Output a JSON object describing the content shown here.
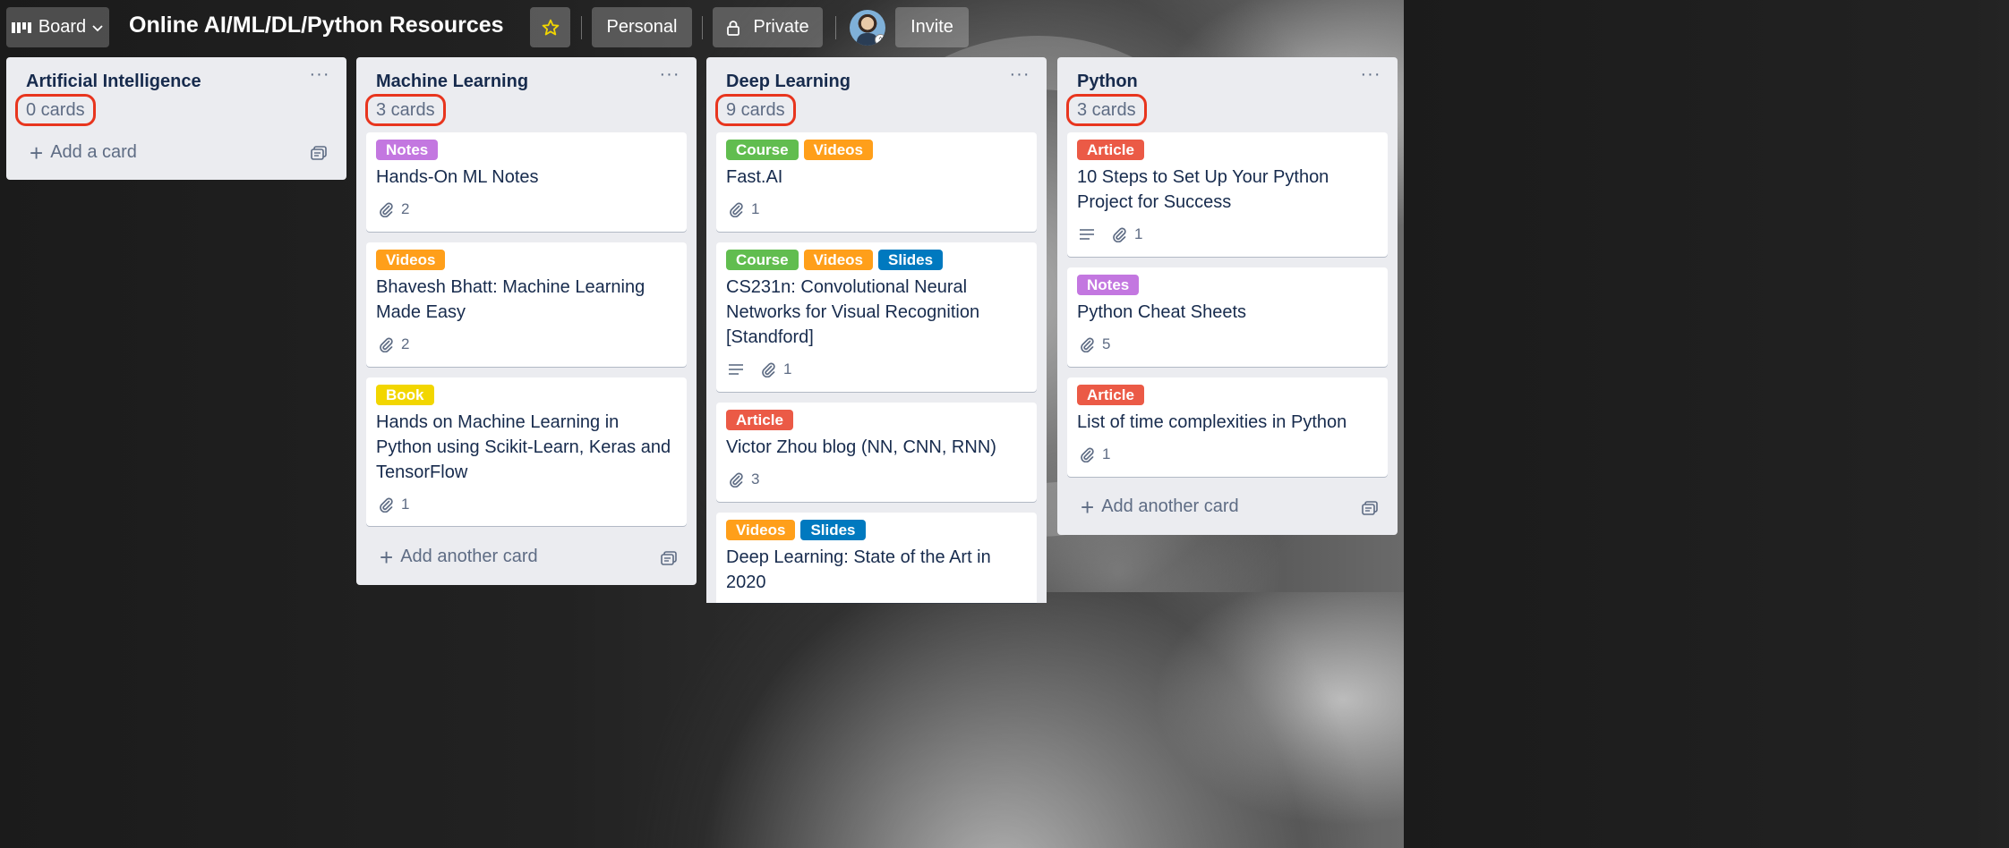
{
  "colors": {
    "notes": "#c377e0",
    "videos": "#ff9f1a",
    "book": "#f2d600",
    "course": "#61bd4f",
    "slides": "#0079bf",
    "article": "#eb5a46",
    "highlight": "#e8351e"
  },
  "header": {
    "board_label": "Board",
    "board_icon": "board-icon",
    "title": "Online AI/ML/DL/Python Resources",
    "star_icon": "star-icon",
    "personal_label": "Personal",
    "private_label": "Private",
    "private_icon": "lock-icon",
    "invite_label": "Invite"
  },
  "lists": [
    {
      "title": "Artificial Intelligence",
      "count": "0 cards",
      "add_label": "Add a card",
      "cards": []
    },
    {
      "title": "Machine Learning",
      "count": "3 cards",
      "add_label": "Add another card",
      "cards": [
        {
          "labels": [
            "Notes"
          ],
          "title": "Hands-On ML Notes",
          "attachments": "2",
          "has_description": false
        },
        {
          "labels": [
            "Videos"
          ],
          "title": "Bhavesh Bhatt: Machine Learning Made Easy",
          "attachments": "2",
          "has_description": false
        },
        {
          "labels": [
            "Book"
          ],
          "title": "Hands on Machine Learning in Python using Scikit-Learn, Keras and TensorFlow",
          "attachments": "1",
          "has_description": false
        }
      ]
    },
    {
      "title": "Deep Learning",
      "count": "9 cards",
      "cards": [
        {
          "labels": [
            "Course",
            "Videos"
          ],
          "title": "Fast.AI",
          "attachments": "1",
          "has_description": false
        },
        {
          "labels": [
            "Course",
            "Videos",
            "Slides"
          ],
          "title": "CS231n: Convolutional Neural Networks for Visual Recognition [Standford]",
          "attachments": "1",
          "has_description": true
        },
        {
          "labels": [
            "Article"
          ],
          "title": "Victor Zhou blog (NN, CNN, RNN)",
          "attachments": "3",
          "has_description": false
        },
        {
          "labels": [
            "Videos",
            "Slides"
          ],
          "title": "Deep Learning: State of the Art in 2020",
          "attachments": "",
          "has_description": false
        }
      ]
    },
    {
      "title": "Python",
      "count": "3 cards",
      "add_label": "Add another card",
      "cards": [
        {
          "labels": [
            "Article"
          ],
          "title": "10 Steps to Set Up Your Python Project for Success",
          "attachments": "1",
          "has_description": true
        },
        {
          "labels": [
            "Notes"
          ],
          "title": "Python Cheat Sheets",
          "attachments": "5",
          "has_description": false
        },
        {
          "labels": [
            "Article"
          ],
          "title": "List of time complexities in Python",
          "attachments": "1",
          "has_description": false
        }
      ]
    }
  ],
  "label_texts": {
    "notes": "Notes",
    "videos": "Videos",
    "book": "Book",
    "course": "Course",
    "slides": "Slides",
    "article": "Article"
  }
}
